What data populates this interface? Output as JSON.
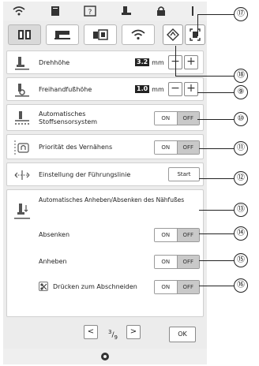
{
  "tabs": [
    {
      "name": "settings-book-icon"
    },
    {
      "name": "machine-icon"
    },
    {
      "name": "embroidery-icon"
    },
    {
      "name": "wifi-icon"
    }
  ],
  "rows": {
    "pivot_height": {
      "label": "Drehhöhe",
      "value": "3.2",
      "unit": "mm"
    },
    "free_motion_height": {
      "label": "Freihandfußhöhe",
      "value": "1.0",
      "unit": "mm"
    },
    "fabric_sensor": {
      "label_line1": "Automatisches",
      "label_line2": "Stoffsensorsystem",
      "on": "ON",
      "off": "OFF",
      "selected": "OFF"
    },
    "priority": {
      "label": "Priorität des Vernähens",
      "on": "ON",
      "off": "OFF",
      "selected": "OFF"
    },
    "guideline": {
      "label": "Einstellung der Führungslinie",
      "button": "Start"
    },
    "auto_lift": {
      "title": "Automatisches Anheben/Absenken des Nähfußes",
      "lower": {
        "label": "Absenken",
        "on": "ON",
        "off": "OFF",
        "selected": "OFF"
      },
      "raise": {
        "label": "Anheben",
        "on": "ON",
        "off": "OFF",
        "selected": "OFF"
      },
      "cut": {
        "label": "Drücken zum Abschneiden",
        "on": "ON",
        "off": "OFF",
        "selected": "OFF"
      }
    }
  },
  "footer": {
    "page_current": "3",
    "page_total": "9",
    "ok": "OK"
  },
  "callouts": [
    "⑰",
    "⑱",
    "⑨",
    "⑩",
    "⑪",
    "⑫",
    "⑬",
    "⑭",
    "⑮",
    "⑯"
  ]
}
